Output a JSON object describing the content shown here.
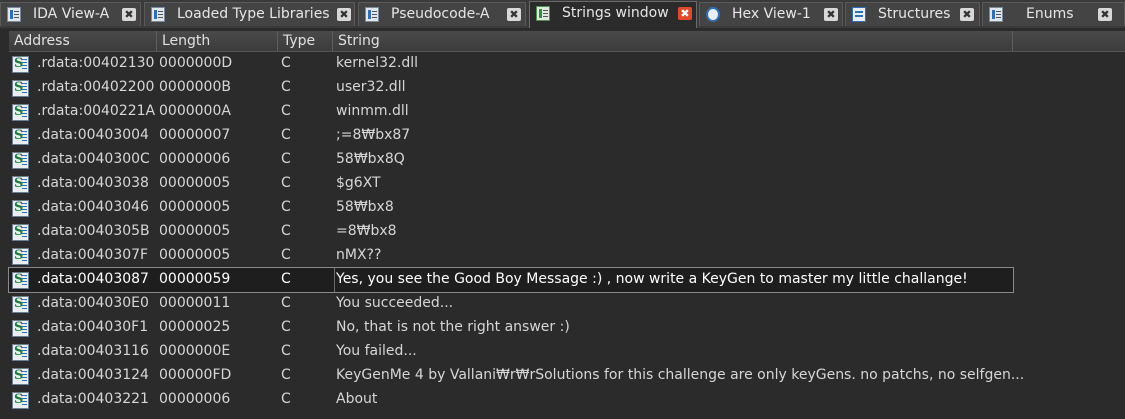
{
  "tabs": [
    {
      "label": "IDA View-A",
      "icon": "ida-view-icon",
      "active": false
    },
    {
      "label": "Loaded Type Libraries",
      "icon": "type-libraries-icon",
      "active": false
    },
    {
      "label": "Pseudocode-A",
      "icon": "pseudocode-icon",
      "active": false
    },
    {
      "label": "Strings window",
      "icon": "strings-icon",
      "active": true
    },
    {
      "label": "Hex View-1",
      "icon": "hex-view-icon",
      "active": false
    },
    {
      "label": "Structures",
      "icon": "structures-icon",
      "active": false
    },
    {
      "label": "Enums",
      "icon": "enums-icon",
      "active": false
    }
  ],
  "close_glyph": "✖",
  "columns": {
    "address": "Address",
    "length": "Length",
    "type": "Type",
    "string": "String"
  },
  "row_icon": "string-icon",
  "rows": [
    {
      "address": ".rdata:00402130",
      "length": "0000000D",
      "type": "C",
      "string": "kernel32.dll"
    },
    {
      "address": ".rdata:00402200",
      "length": "0000000B",
      "type": "C",
      "string": "user32.dll"
    },
    {
      "address": ".rdata:0040221A",
      "length": "0000000A",
      "type": "C",
      "string": "winmm.dll"
    },
    {
      "address": ".data:00403004",
      "length": "00000007",
      "type": "C",
      "string": ";=8₩bx87"
    },
    {
      "address": ".data:0040300C",
      "length": "00000006",
      "type": "C",
      "string": "58₩bx8Q"
    },
    {
      "address": ".data:00403038",
      "length": "00000005",
      "type": "C",
      "string": "$g6XT"
    },
    {
      "address": ".data:00403046",
      "length": "00000005",
      "type": "C",
      "string": "58₩bx8"
    },
    {
      "address": ".data:0040305B",
      "length": "00000005",
      "type": "C",
      "string": "=8₩bx8"
    },
    {
      "address": ".data:0040307F",
      "length": "00000005",
      "type": "C",
      "string": "nMX??"
    },
    {
      "address": ".data:00403087",
      "length": "00000059",
      "type": "C",
      "string": "Yes, you see the Good Boy Message :) , now write a KeyGen to master my little challange!",
      "selected": true
    },
    {
      "address": ".data:004030E0",
      "length": "00000011",
      "type": "C",
      "string": "You succeeded..."
    },
    {
      "address": ".data:004030F1",
      "length": "00000025",
      "type": "C",
      "string": "No, that is not the right answer :)"
    },
    {
      "address": ".data:00403116",
      "length": "0000000E",
      "type": "C",
      "string": "You failed..."
    },
    {
      "address": ".data:00403124",
      "length": "000000FD",
      "type": "C",
      "string": "KeyGenMe 4 by Vallani₩r₩rSolutions for this challenge are only keyGens. no patchs, no selfgen..."
    },
    {
      "address": ".data:00403221",
      "length": "00000006",
      "type": "C",
      "string": "About"
    }
  ]
}
